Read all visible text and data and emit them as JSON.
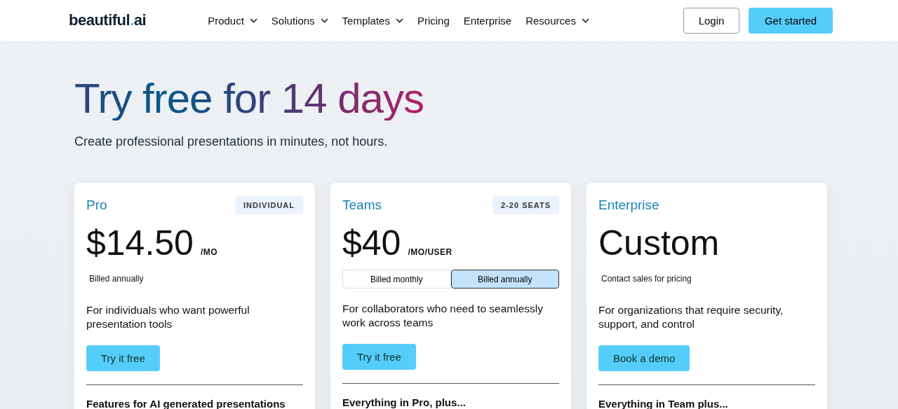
{
  "nav": {
    "logo": [
      "beautiful",
      ".",
      "ai"
    ],
    "menu": [
      {
        "label": "Product",
        "dropdown": true
      },
      {
        "label": "Solutions",
        "dropdown": true
      },
      {
        "label": "Templates",
        "dropdown": true
      },
      {
        "label": "Pricing",
        "dropdown": false
      },
      {
        "label": "Enterprise",
        "dropdown": false
      },
      {
        "label": "Resources",
        "dropdown": true
      }
    ],
    "login": "Login",
    "cta": "Get started"
  },
  "hero": {
    "title": "Try free for 14 days",
    "subtitle": "Create professional presentations in minutes, not hours."
  },
  "plans": [
    {
      "name": "Pro",
      "badge": "INDIVIDUAL",
      "price": "$14.50",
      "unit": "/MO",
      "note": "Billed annually",
      "description": "For individuals who want powerful presentation tools",
      "button": "Try it free",
      "features_heading": "Features for AI generated presentations"
    },
    {
      "name": "Teams",
      "badge": "2-20 SEATS",
      "price": "$40",
      "unit": "/MO/USER",
      "billing": [
        {
          "label": "Billed monthly",
          "selected": false
        },
        {
          "label": "Billed annually",
          "selected": true
        }
      ],
      "description": "For collaborators who need to seamlessly work across teams",
      "button": "Try it free",
      "features_heading": "Everything in Pro, plus..."
    },
    {
      "name": "Enterprise",
      "price": "Custom",
      "note": "Contact sales for pricing",
      "description": "For organizations that require security, support, and control",
      "button": "Book a demo",
      "features_heading": "Everything in Team plus..."
    }
  ]
}
